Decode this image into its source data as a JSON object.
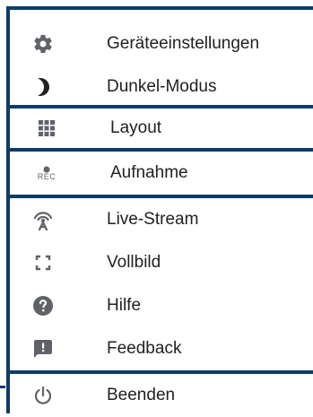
{
  "menu": {
    "items": [
      {
        "label": "Geräteeinstellungen",
        "icon": "gear-icon"
      },
      {
        "label": "Dunkel-Modus",
        "icon": "moon-icon"
      },
      {
        "label": "Layout",
        "icon": "grid-icon"
      },
      {
        "label": "Aufnahme",
        "icon": "record-icon",
        "icon_text": "REC"
      },
      {
        "label": "Live-Stream",
        "icon": "broadcast-icon"
      },
      {
        "label": "Vollbild",
        "icon": "fullscreen-icon"
      },
      {
        "label": "Hilfe",
        "icon": "help-icon"
      },
      {
        "label": "Feedback",
        "icon": "feedback-icon"
      },
      {
        "label": "Beenden",
        "icon": "power-icon"
      }
    ]
  },
  "colors": {
    "frame": "#0e3c68",
    "icon": "#5f6368",
    "text": "#202124"
  }
}
